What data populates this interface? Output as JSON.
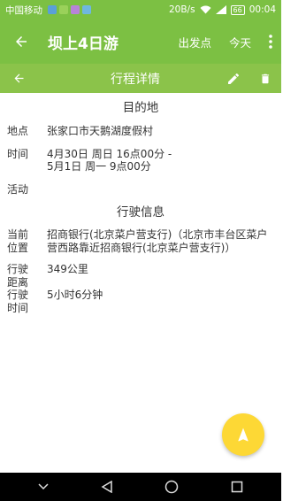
{
  "status_bar": {
    "carrier": "中国移动",
    "network_speed": "20B/s",
    "battery": "66",
    "time": "00:04"
  },
  "app_bar": {
    "title": "坝上4日游",
    "departure_label": "出发点",
    "today_label": "今天"
  },
  "sub_bar": {
    "title": "行程详情"
  },
  "destination": {
    "section_title": "目的地",
    "place_label": "地点",
    "place_value": "张家口市天鹅湖度假村",
    "time_label": "时间",
    "time_line1": "4月30日 周日 16点00分 -",
    "time_line2": "5月1日 周一 9点00分",
    "activity_label": "活动",
    "activity_value": ""
  },
  "driving": {
    "section_title": "行驶信息",
    "current_location_label_1": "当前",
    "current_location_label_2": "位置",
    "current_location_value": "招商银行(北京菜户营支行)（北京市丰台区菜户营西路靠近招商银行(北京菜户营支行)）",
    "distance_label_1": "行驶",
    "distance_label_2": "距离",
    "distance_value": "349公里",
    "duration_label_1": "行驶",
    "duration_label_2": "时间",
    "duration_value": "5小时6分钟"
  },
  "colors": {
    "app_bar": "#7cc043",
    "sub_bar": "#8bc34a",
    "fab": "#fdd835"
  }
}
